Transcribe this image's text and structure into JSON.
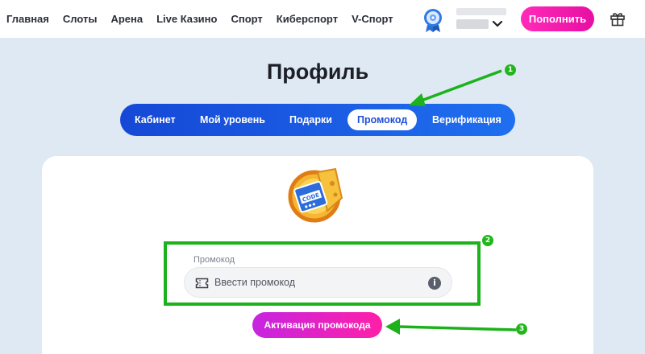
{
  "nav": {
    "items": [
      "Главная",
      "Слоты",
      "Арена",
      "Live Казино",
      "Спорт",
      "Киберспорт",
      "V-Спорт"
    ]
  },
  "header": {
    "deposit_label": "Пополнить"
  },
  "page": {
    "title": "Профиль"
  },
  "tabs": [
    {
      "label": "Кабинет",
      "active": false
    },
    {
      "label": "Мой уровень",
      "active": false
    },
    {
      "label": "Подарки",
      "active": false
    },
    {
      "label": "Промокод",
      "active": true
    },
    {
      "label": "Верификация",
      "active": false
    }
  ],
  "promo": {
    "field_label": "Промокод",
    "placeholder": "Ввести промокод",
    "info_glyph": "i",
    "activate_label": "Активация промокода"
  },
  "art": {
    "coupon_text": "CODE"
  },
  "annotations": {
    "markers": [
      "1",
      "2",
      "3"
    ]
  },
  "colors": {
    "accent_pink": "#ff2bb8",
    "tab_blue": "#1f4fd9",
    "annotation_green": "#1bb21b",
    "background": "#dfe9f3"
  },
  "icons": [
    "avatar-badge-icon",
    "chevron-down-icon",
    "gift-icon",
    "ticket-icon",
    "info-icon",
    "promo-coupon-illustration"
  ]
}
